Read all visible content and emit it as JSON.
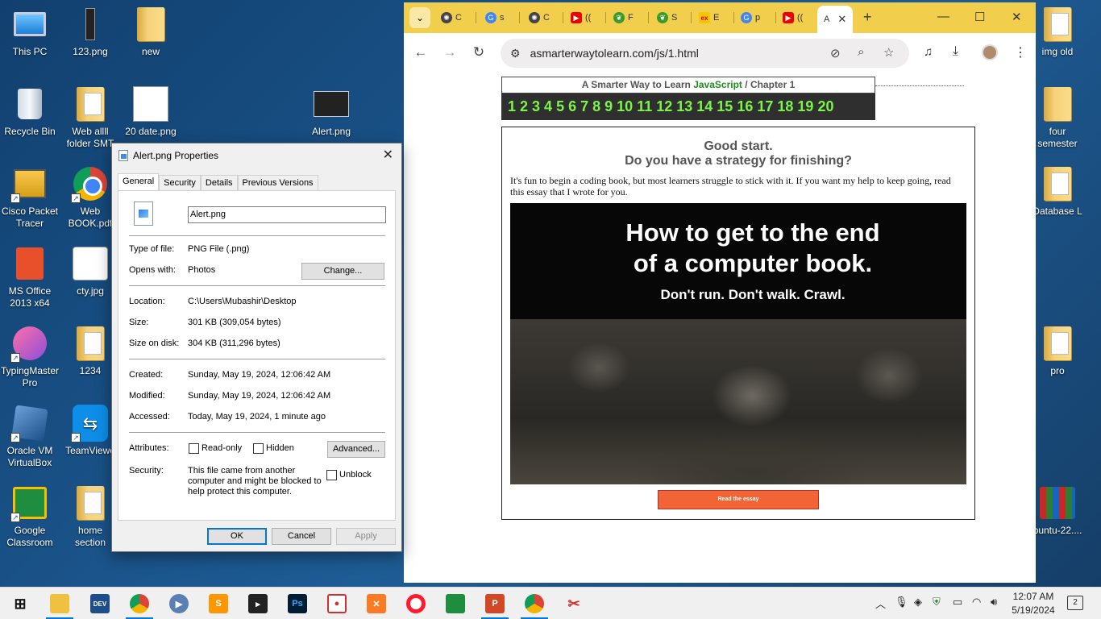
{
  "desktop": {
    "icons_left": [
      {
        "label": "This PC",
        "icon": "this-pc-icon"
      },
      {
        "label": "123.png",
        "icon": "image-file-icon"
      },
      {
        "label": "new",
        "icon": "folder-icon"
      },
      {
        "label": "Recycle Bin",
        "icon": "recycle-bin-icon"
      },
      {
        "label": "Web allll folder SMT",
        "icon": "folder-icon"
      },
      {
        "label": "20 date.png",
        "icon": "image-file-icon"
      },
      {
        "label": "Alert.png",
        "icon": "image-file-icon"
      },
      {
        "label": "Cisco Packet Tracer",
        "icon": "cisco-packet-tracer-icon"
      },
      {
        "label": "Web BOOK.pdf",
        "icon": "chrome-pdf-icon"
      },
      {
        "label": "MS Office 2013 x64",
        "icon": "ms-office-icon"
      },
      {
        "label": "cty.jpg",
        "icon": "image-file-icon"
      },
      {
        "label": "TypingMaster Pro",
        "icon": "typingmaster-icon"
      },
      {
        "label": "1234",
        "icon": "folder-icon"
      },
      {
        "label": "Oracle VM VirtualBox",
        "icon": "virtualbox-icon"
      },
      {
        "label": "TeamViewe",
        "icon": "teamviewer-icon"
      },
      {
        "label": "Google Classroom",
        "icon": "google-classroom-icon"
      },
      {
        "label": "home section",
        "icon": "folder-icon"
      }
    ],
    "icons_right": [
      {
        "label": "img old",
        "icon": "folder-icon"
      },
      {
        "label": "four semester",
        "icon": "folder-icon"
      },
      {
        "label": "Database L",
        "icon": "folder-icon"
      },
      {
        "label": "pro",
        "icon": "folder-icon"
      },
      {
        "label": "buntu-22....",
        "icon": "winrar-icon"
      }
    ]
  },
  "browser": {
    "tabs": [
      {
        "label": "C",
        "icon": "chatgpt-icon"
      },
      {
        "label": "s",
        "icon": "google-icon"
      },
      {
        "label": "C",
        "icon": "chatgpt-icon"
      },
      {
        "label": "((",
        "icon": "youtube-icon"
      },
      {
        "label": "F",
        "icon": "green-leaf-icon"
      },
      {
        "label": "S",
        "icon": "green-leaf-icon"
      },
      {
        "label": "E",
        "icon": "ex-icon"
      },
      {
        "label": "p",
        "icon": "google-icon"
      },
      {
        "label": "((",
        "icon": "youtube-icon"
      },
      {
        "label": "A",
        "icon": "page-icon",
        "active": true
      }
    ],
    "url": "asmarterwaytolearn.com/js/1.html",
    "page": {
      "chapter_header_prefix": "A Smarter Way to Learn",
      "chapter_header_js": "JavaScript",
      "chapter_header_sep": "/",
      "chapter_header_suffix": "Chapter 1",
      "chapter_numbers": [
        "1",
        "2",
        "3",
        "4",
        "5",
        "6",
        "7",
        "8",
        "9",
        "10",
        "11",
        "12",
        "13",
        "14",
        "15",
        "16",
        "17",
        "18",
        "19",
        "20"
      ],
      "heading_line1": "Good start.",
      "heading_line2": "Do you have a strategy for finishing?",
      "body_text": "It's fun to begin a coding book, but most learners struggle to stick with it. If you want my help to keep going, read this essay that I wrote for you.",
      "banner_line1": "How to get to the end",
      "banner_line2": "of a computer book.",
      "banner_line3": "Don't run. Don't walk. Crawl.",
      "read_button": "Read the essay"
    }
  },
  "dialog": {
    "title": "Alert.png Properties",
    "tabs": [
      "General",
      "Security",
      "Details",
      "Previous Versions"
    ],
    "filename": "Alert.png",
    "type_label": "Type of file:",
    "type_value": "PNG File (.png)",
    "opens_label": "Opens with:",
    "opens_value": "Photos",
    "change_button": "Change...",
    "location_label": "Location:",
    "location_value": "C:\\Users\\Mubashir\\Desktop",
    "size_label": "Size:",
    "size_value": "301 KB (309,054 bytes)",
    "size_on_disk_label": "Size on disk:",
    "size_on_disk_value": "304 KB (311,296 bytes)",
    "created_label": "Created:",
    "created_value": "Sunday, May 19, 2024, 12:06:42 AM",
    "modified_label": "Modified:",
    "modified_value": "Sunday, May 19, 2024, 12:06:42 AM",
    "accessed_label": "Accessed:",
    "accessed_value": "Today, May 19, 2024, 1 minute ago",
    "attributes_label": "Attributes:",
    "readonly_label": "Read-only",
    "hidden_label": "Hidden",
    "advanced_button": "Advanced...",
    "security_label": "Security:",
    "security_text": "This file came from another computer and might be blocked to help protect this computer.",
    "unblock_label": "Unblock",
    "ok_button": "OK",
    "cancel_button": "Cancel",
    "apply_button": "Apply"
  },
  "taskbar": {
    "dev_label": "DEV",
    "clock_time": "12:07 AM",
    "clock_date": "5/19/2024",
    "notification_count": "2"
  }
}
